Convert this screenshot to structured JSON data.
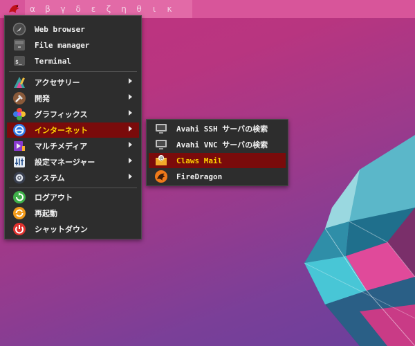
{
  "panel": {
    "desktops": [
      "α",
      "β",
      "γ",
      "δ",
      "ε",
      "ζ",
      "η",
      "θ",
      "ι",
      "κ"
    ]
  },
  "main_menu": {
    "apps": [
      {
        "label": "Web browser",
        "icon": "browser-icon"
      },
      {
        "label": "File manager",
        "icon": "file-manager-icon"
      },
      {
        "label": "Terminal",
        "icon": "terminal-icon"
      }
    ],
    "categories": [
      {
        "label": "アクセサリー",
        "icon": "accessories-icon"
      },
      {
        "label": "開発",
        "icon": "development-icon"
      },
      {
        "label": "グラフィックス",
        "icon": "graphics-icon"
      },
      {
        "label": "インターネット",
        "icon": "internet-icon",
        "active": true
      },
      {
        "label": "マルチメディア",
        "icon": "multimedia-icon"
      },
      {
        "label": "設定マネージャー",
        "icon": "settings-manager-icon"
      },
      {
        "label": "システム",
        "icon": "system-icon"
      }
    ],
    "actions": [
      {
        "label": "ログアウト",
        "icon": "logout-icon"
      },
      {
        "label": "再起動",
        "icon": "restart-icon"
      },
      {
        "label": "シャットダウン",
        "icon": "shutdown-icon"
      }
    ]
  },
  "internet_submenu": {
    "items": [
      {
        "label": "Avahi SSH サーバの検索",
        "icon": "network-server-icon"
      },
      {
        "label": "Avahi VNC サーバの検索",
        "icon": "network-server-icon"
      },
      {
        "label": "Claws Mail",
        "icon": "mail-icon",
        "active": true
      },
      {
        "label": "FireDragon",
        "icon": "firedragon-icon"
      }
    ]
  },
  "colors": {
    "panel": "#d8559a",
    "menu_bg": "#2d2d2d",
    "active_bg": "#7a0b0b",
    "active_text": "#ffd200"
  }
}
